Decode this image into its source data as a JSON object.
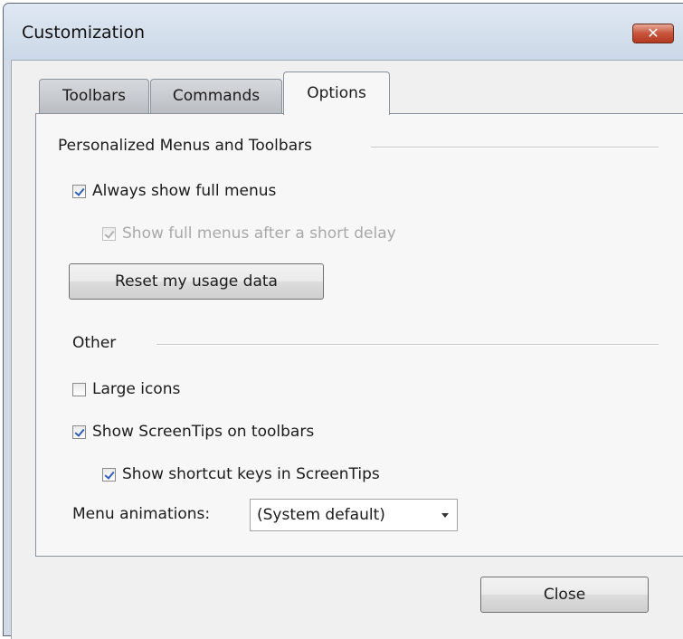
{
  "window": {
    "title": "Customization",
    "close_label": "✕"
  },
  "tabs": [
    {
      "label": "Toolbars"
    },
    {
      "label": "Commands"
    },
    {
      "label": "Options"
    }
  ],
  "personalized": {
    "heading": "Personalized Menus and Toolbars",
    "always_full_menus": {
      "label": "Always show full menus",
      "checked": true
    },
    "full_after_delay": {
      "label": "Show full menus after a short delay",
      "checked": true,
      "disabled": true
    },
    "reset_button": "Reset my usage data"
  },
  "other": {
    "heading": "Other",
    "large_icons": {
      "label": "Large icons",
      "checked": false
    },
    "screentips": {
      "label": "Show ScreenTips on toolbars",
      "checked": true
    },
    "shortcut_keys": {
      "label": "Show shortcut keys in ScreenTips",
      "checked": true
    },
    "menu_animations_label": "Menu animations:",
    "menu_animations_value": "(System default)"
  },
  "footer": {
    "close_button": "Close"
  },
  "colors": {
    "titlebar": "#d2dae6",
    "client": "#f0f0f0",
    "check": "#2f5fb8",
    "close_x": "#c8543c"
  }
}
